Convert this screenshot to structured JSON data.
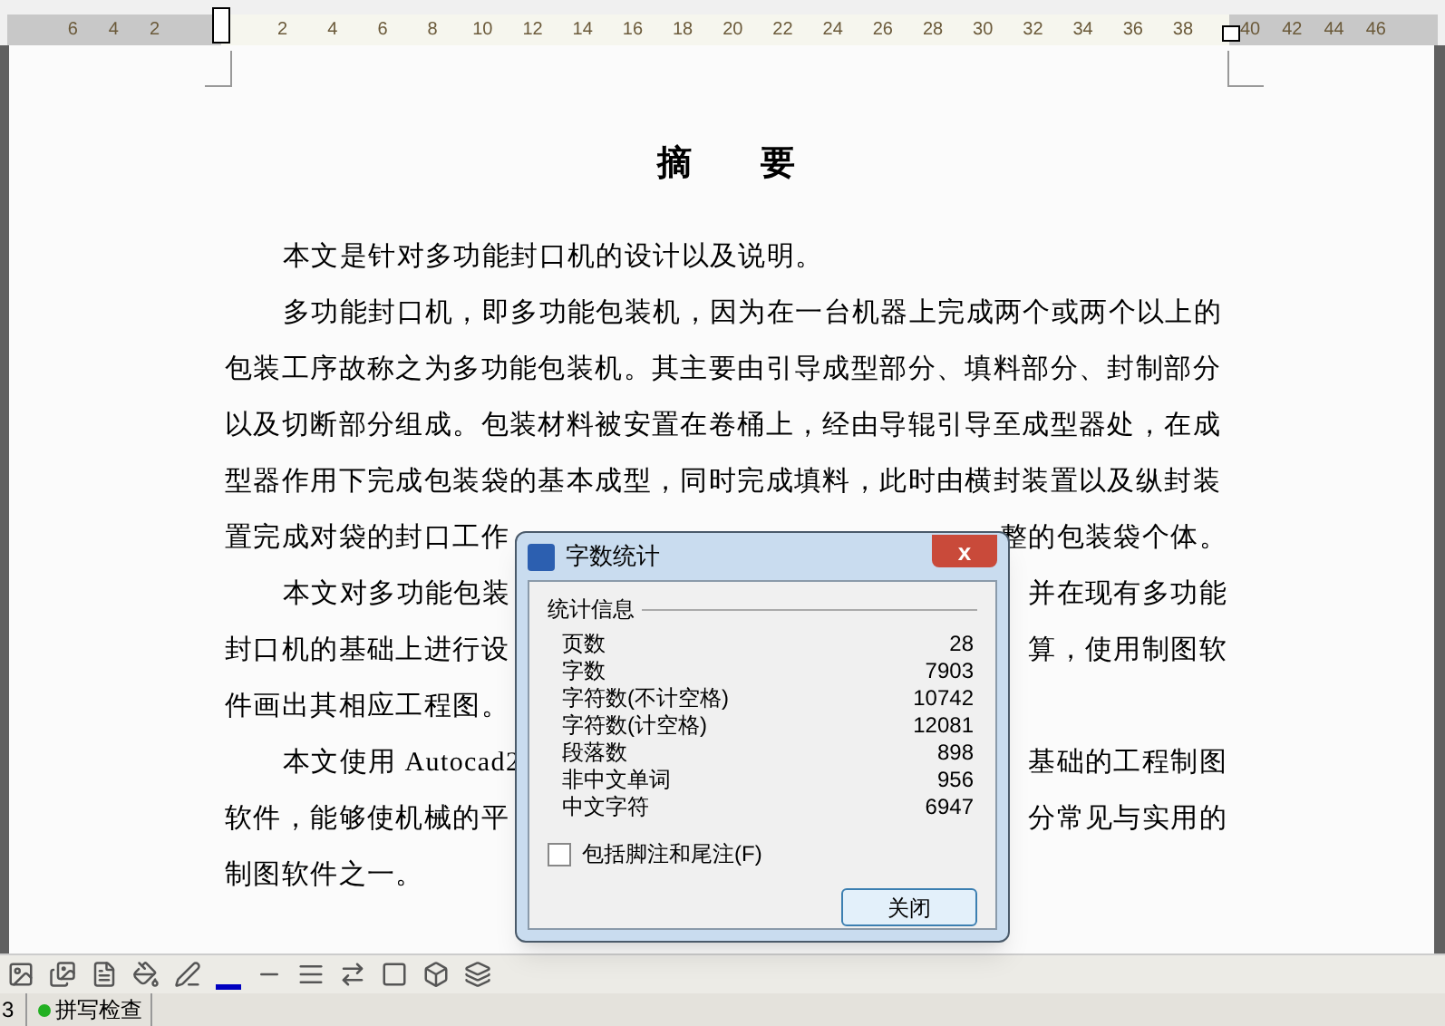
{
  "ruler": {
    "left_numbers": [
      "6",
      "4",
      "2"
    ],
    "numbers": [
      "2",
      "4",
      "6",
      "8",
      "10",
      "12",
      "14",
      "16",
      "18",
      "20",
      "22",
      "24",
      "26",
      "28",
      "30",
      "32",
      "34",
      "36",
      "38"
    ],
    "right_numbers": [
      "40",
      "42",
      "44",
      "46"
    ]
  },
  "document": {
    "title": "摘　　要",
    "paragraphs": [
      {
        "lines": [
          {
            "left": "本文是针对多功能封口机的设计以及说明。"
          }
        ]
      },
      {
        "lines": [
          {
            "left": "多功能封口机，即多功能包装机，因为在一台机器上完成两个或两个以上的"
          },
          {
            "left": "包装工序故称之为多功能包装机。其主要由引导成型部分、填料部分、封制部分"
          },
          {
            "left": "以及切断部分组成。包装材料被安置在卷桶上，经由导辊引导至成型器处，在成"
          },
          {
            "left": "型器作用下完成包装袋的基本成型，同时完成填料，此时由横封装置以及纵封装"
          },
          {
            "left": "置完成对袋的封口工作",
            "right": "整的包装袋个体。"
          }
        ]
      },
      {
        "lines": [
          {
            "left": "本文对多功能包装",
            "right": "并在现有多功能"
          },
          {
            "left": "封口机的基础上进行设",
            "right": "算，使用制图软"
          },
          {
            "left": "件画出其相应工程图。"
          }
        ]
      },
      {
        "lines": [
          {
            "left": "本文使用 Autocad2",
            "right": "基础的工程制图"
          },
          {
            "left": "软件，能够使机械的平",
            "right": "分常见与实用的"
          },
          {
            "left": "制图软件之一。"
          }
        ]
      }
    ]
  },
  "dialog": {
    "title": "字数统计",
    "close_glyph": "x",
    "group_title": "统计信息",
    "stats": [
      {
        "label": "页数",
        "value": "28"
      },
      {
        "label": "字数",
        "value": "7903"
      },
      {
        "label": "字符数(不计空格)",
        "value": "10742"
      },
      {
        "label": "字符数(计空格)",
        "value": "12081"
      },
      {
        "label": "段落数",
        "value": "898"
      },
      {
        "label": "非中文单词",
        "value": "956"
      },
      {
        "label": "中文字符",
        "value": "6947"
      }
    ],
    "checkbox": {
      "label": "包括脚注和尾注(F)",
      "checked": false
    },
    "button": "关闭"
  },
  "status_bar": {
    "page": "3",
    "spell_check": "拼写检查"
  }
}
